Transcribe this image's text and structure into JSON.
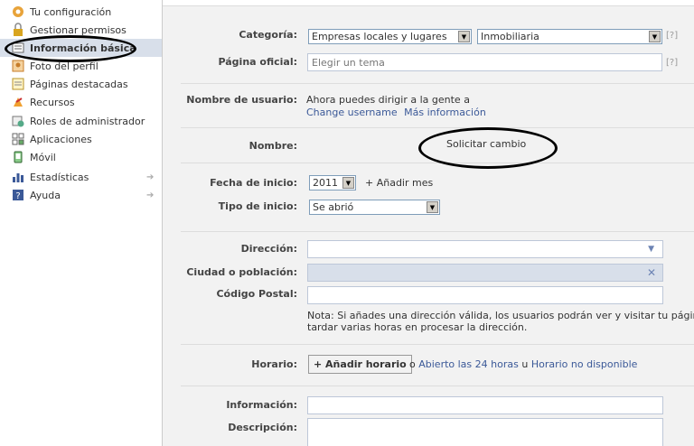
{
  "sidebar": {
    "items": [
      {
        "label": "Tu configuración",
        "icon": "settings-icon"
      },
      {
        "label": "Gestionar permisos",
        "icon": "lock-icon"
      },
      {
        "label": "Información básica",
        "icon": "info-icon",
        "active": true
      },
      {
        "label": "Foto del perfil",
        "icon": "photo-icon"
      },
      {
        "label": "Páginas destacadas",
        "icon": "featured-icon"
      },
      {
        "label": "Recursos",
        "icon": "resources-icon"
      },
      {
        "label": "Roles de administrador",
        "icon": "admin-roles-icon"
      },
      {
        "label": "Aplicaciones",
        "icon": "apps-icon"
      },
      {
        "label": "Móvil",
        "icon": "mobile-icon"
      },
      {
        "label": "Estadísticas",
        "icon": "stats-icon"
      },
      {
        "label": "Ayuda",
        "icon": "help-icon"
      }
    ]
  },
  "form": {
    "categoria": {
      "label": "Categoría:",
      "value1": "Empresas locales y lugares",
      "value2": "Inmobiliaria",
      "help": "[?]"
    },
    "pagina_oficial": {
      "label": "Página oficial:",
      "placeholder": "Elegir un tema",
      "help": "[?]"
    },
    "usuario": {
      "label": "Nombre de usuario:",
      "text": "Ahora puedes dirigir a la gente a",
      "link1": "Change username",
      "link2": "Más información"
    },
    "nombre": {
      "label": "Nombre:",
      "link": "Solicitar cambio"
    },
    "fecha_inicio": {
      "label": "Fecha de inicio:",
      "year": "2011",
      "add_month": "+ Añadir mes"
    },
    "tipo_inicio": {
      "label": "Tipo de inicio:",
      "value": "Se abrió"
    },
    "direccion": {
      "label": "Dirección:",
      "value": ""
    },
    "ciudad": {
      "label": "Ciudad o población:",
      "value": ""
    },
    "codigo_postal": {
      "label": "Código Postal:",
      "value": ""
    },
    "nota": {
      "line1": "Nota: Si añades una dirección válida, los usuarios podrán ver y visitar tu página usando Luga",
      "line2": "tardar varias horas en procesar la dirección."
    },
    "horario": {
      "label": "Horario:",
      "button": "+ Añadir horario",
      "or1": "o",
      "link1": "Abierto las 24 horas",
      "or2": "u",
      "link2": "Horario no disponible"
    },
    "informacion": {
      "label": "Información:",
      "value": ""
    },
    "descripcion": {
      "label": "Descripción:",
      "value": ""
    }
  }
}
